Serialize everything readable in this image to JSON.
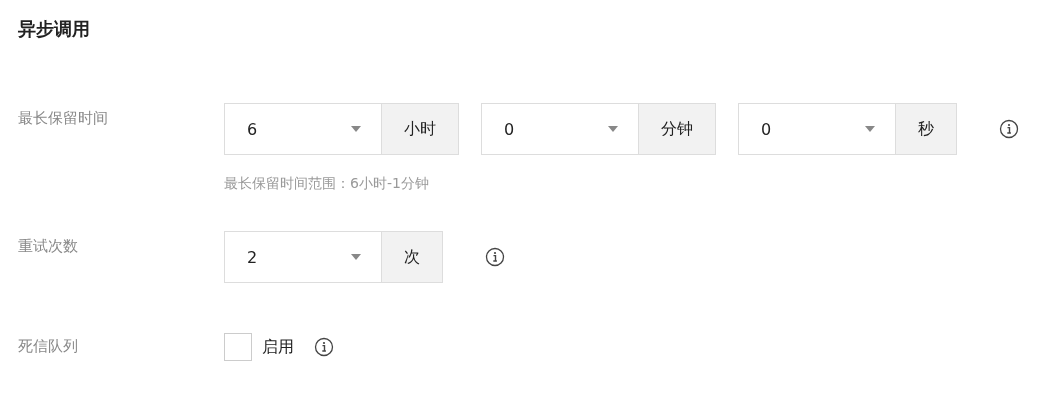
{
  "section_title": "异步调用",
  "fields": [
    {
      "label": "最长保留时间",
      "kind": "selects",
      "inputs": [
        {
          "value": "6",
          "unit": "小时"
        },
        {
          "value": "0",
          "unit": "分钟"
        },
        {
          "value": "0",
          "unit": "秒"
        }
      ],
      "info": true,
      "hint": "最长保留时间范围：6小时-1分钟"
    },
    {
      "label": "重试次数",
      "kind": "selects",
      "inputs": [
        {
          "value": "2",
          "unit": "次"
        }
      ],
      "info": true
    },
    {
      "label": "死信队列",
      "kind": "checkbox",
      "checked": false,
      "text": "启用",
      "info": true
    }
  ]
}
